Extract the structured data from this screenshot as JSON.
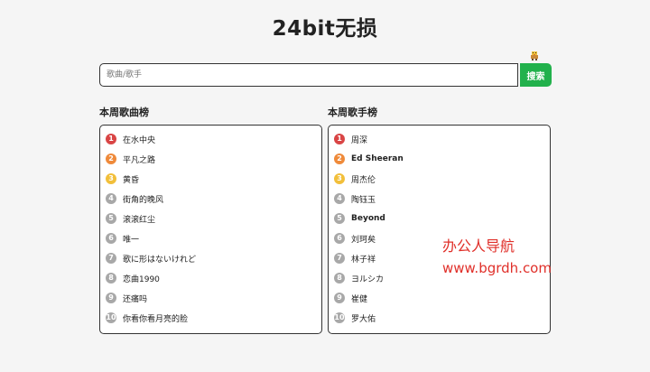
{
  "page": {
    "title": "24bit无损"
  },
  "search": {
    "placeholder": "歌曲/歌手",
    "button_label": "搜索"
  },
  "song_chart": {
    "title": "本周歌曲榜",
    "items": [
      {
        "rank": "1",
        "name": "在水中央"
      },
      {
        "rank": "2",
        "name": "平凡之路"
      },
      {
        "rank": "3",
        "name": "黄昏"
      },
      {
        "rank": "4",
        "name": "街角的晚风"
      },
      {
        "rank": "5",
        "name": "滚滚红尘"
      },
      {
        "rank": "6",
        "name": "唯一"
      },
      {
        "rank": "7",
        "name": "歌に形はないけれど"
      },
      {
        "rank": "8",
        "name": "恋曲1990"
      },
      {
        "rank": "9",
        "name": "还痛吗"
      },
      {
        "rank": "10",
        "name": "你看你看月亮的脸"
      }
    ]
  },
  "artist_chart": {
    "title": "本周歌手榜",
    "items": [
      {
        "rank": "1",
        "name": "周深"
      },
      {
        "rank": "2",
        "name": "Ed Sheeran"
      },
      {
        "rank": "3",
        "name": "周杰伦"
      },
      {
        "rank": "4",
        "name": "陶钰玉"
      },
      {
        "rank": "5",
        "name": "Beyond"
      },
      {
        "rank": "6",
        "name": "刘珂矣"
      },
      {
        "rank": "7",
        "name": "林子祥"
      },
      {
        "rank": "8",
        "name": "ヨルシカ"
      },
      {
        "rank": "9",
        "name": "崔健"
      },
      {
        "rank": "10",
        "name": "罗大佑"
      }
    ]
  },
  "watermark": {
    "line1": "办公人导航",
    "line2": "www.bgrdh.com"
  },
  "colors": {
    "accent": "#22b14c",
    "rank1": "#d94545",
    "rank2": "#ef8a3a",
    "rank3": "#f2bf3a",
    "rank_other": "#a8a8a8",
    "watermark": "#e0302a"
  },
  "icons": {
    "mascot": "pixel-chick-icon"
  }
}
